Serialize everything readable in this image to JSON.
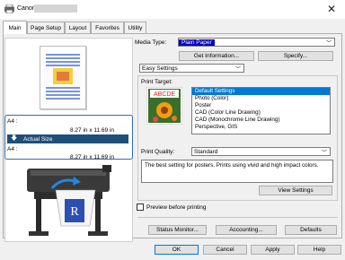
{
  "window": {
    "title": "Canon"
  },
  "tabs": [
    {
      "label": "Main"
    },
    {
      "label": "Page Setup"
    },
    {
      "label": "Layout"
    },
    {
      "label": "Favorites"
    },
    {
      "label": "Utility"
    }
  ],
  "preview": {
    "paper_label_1": "A4 :",
    "paper_size_1": "8.27 in x 11.69 in",
    "actual_size_label": "Actual Size",
    "paper_label_2": "A4 :",
    "paper_size_2": "8.27 in x 11.69 in"
  },
  "media": {
    "label": "Media Type:",
    "value": "Plain Paper",
    "get_info_button": "Get Information...",
    "specify_button": "Specify..."
  },
  "settings_mode": {
    "value": "Easy Settings"
  },
  "print_target": {
    "label": "Print Target:",
    "thumb_text": "ABCDE",
    "items": [
      "Default Settings",
      "Photo (Color)",
      "Poster",
      "CAD (Color Line Drawing)",
      "CAD (Monochrome Line Drawing)",
      "Perspective, GIS"
    ],
    "selected": 0
  },
  "print_quality": {
    "label": "Print Quality:",
    "value": "Standard"
  },
  "description": "The best setting for posters. Prints using vivid and high impact colors.",
  "view_settings_button": "View Settings",
  "preview_checkbox": {
    "label": "Preview before printing",
    "checked": false
  },
  "bottom_buttons": {
    "status_monitor": "Status Monitor...",
    "accounting": "Accounting...",
    "defaults": "Defaults"
  },
  "dialog_buttons": {
    "ok": "OK",
    "cancel": "Cancel",
    "apply": "Apply",
    "help": "Help"
  },
  "colors": {
    "accent": "#0078d7",
    "frame_blue": "#2f6fa8",
    "media_highlight": "#0000c0"
  }
}
